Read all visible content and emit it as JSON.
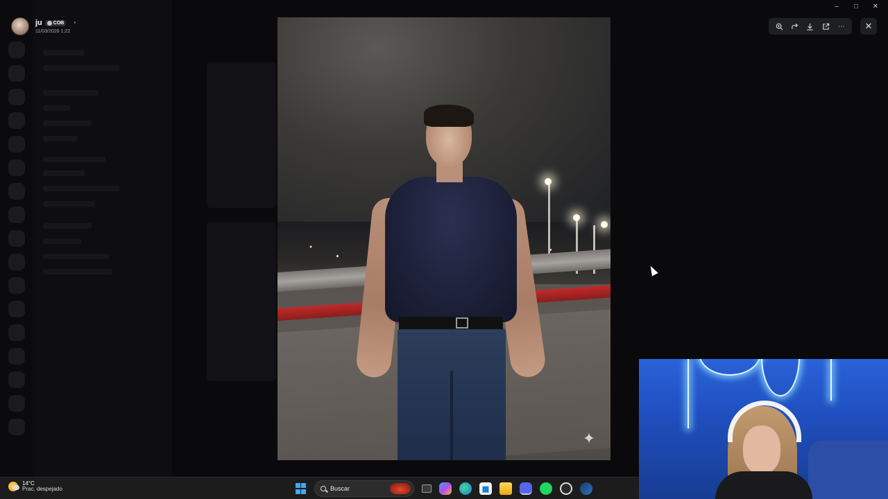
{
  "viewer": {
    "username": "ju",
    "tag": "COB",
    "timestamp": "11/03/2026 1:22"
  },
  "toolbar": {
    "icons": [
      "zoom-in-icon",
      "forward-icon",
      "download-icon",
      "open-external-icon",
      "more-icon"
    ],
    "close_icon": "close-icon"
  },
  "taskbar": {
    "weather_temp": "14°C",
    "weather_condition": "Prac. despejado",
    "search_label": "Buscar"
  },
  "colors": {
    "accent": "#3fa9f5",
    "toolbar_bg": "#1e1f22",
    "taskbar_bg": "#1c1c1c"
  }
}
